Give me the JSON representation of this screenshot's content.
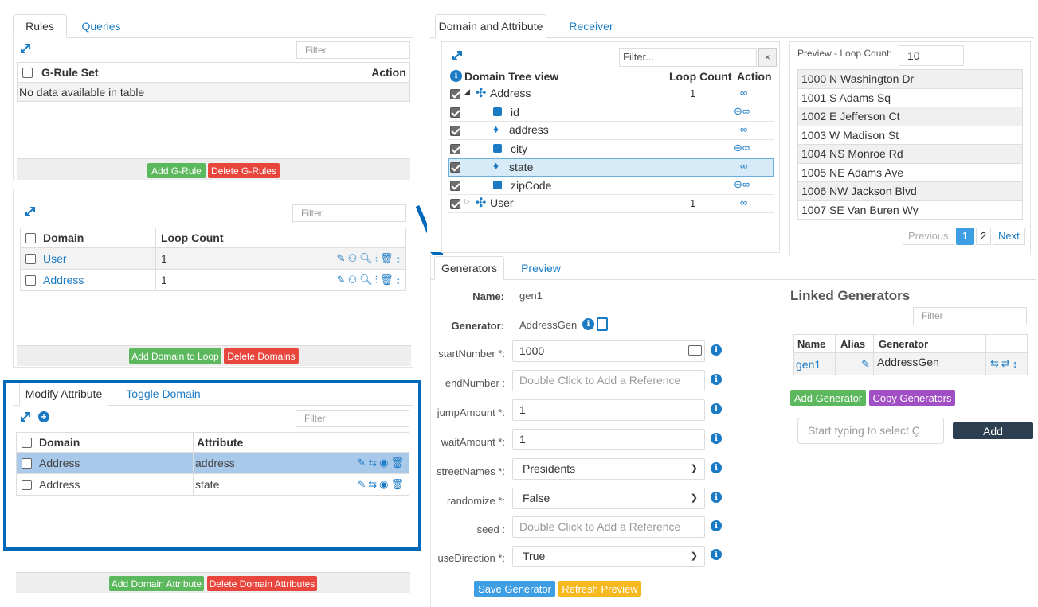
{
  "left_top": {
    "tabs": [
      "Rules",
      "Queries"
    ],
    "filter_placeholder": "Filter",
    "columns": [
      "G-Rule Set",
      "Action"
    ],
    "empty_text": "No data available in table",
    "buttons": {
      "add": "Add G-Rule",
      "delete": "Delete G-Rules"
    }
  },
  "left_mid": {
    "filter_placeholder": "Filter",
    "columns": [
      "Domain",
      "Loop Count"
    ],
    "rows": [
      {
        "domain": "User",
        "loop_count": "1"
      },
      {
        "domain": "Address",
        "loop_count": "1"
      }
    ],
    "buttons": {
      "add": "Add Domain to Loop",
      "delete": "Delete Domains"
    }
  },
  "left_bottom": {
    "tabs": [
      "Modify Attribute",
      "Toggle Domain"
    ],
    "filter_placeholder": "Filter",
    "columns": [
      "Domain",
      "Attribute"
    ],
    "rows": [
      {
        "domain": "Address",
        "attribute": "address"
      },
      {
        "domain": "Address",
        "attribute": "state"
      }
    ],
    "buttons": {
      "add": "Add Domain Attribute",
      "delete": "Delete Domain Attributes"
    }
  },
  "domain_panel": {
    "tabs": [
      "Domain and Attribute",
      "Receiver"
    ],
    "filter_placeholder": "Filter...",
    "clear_label": "×",
    "columns": {
      "tree": "Domain Tree view",
      "loop": "Loop Count",
      "action": "Action"
    },
    "tree": [
      {
        "label": "Address",
        "loop": "1"
      },
      {
        "label": "id",
        "loop": ""
      },
      {
        "label": "address",
        "loop": ""
      },
      {
        "label": "city",
        "loop": ""
      },
      {
        "label": "state",
        "loop": ""
      },
      {
        "label": "zipCode",
        "loop": ""
      },
      {
        "label": "User",
        "loop": "1"
      }
    ]
  },
  "preview": {
    "label": "Preview - Loop Count:",
    "loop_count": "10",
    "items": [
      "1000 N Washington Dr",
      "1001 S Adams Sq",
      "1002 E Jefferson Ct",
      "1003 W Madison St",
      "1004 NS Monroe Rd",
      "1005 NE Adams Ave",
      "1006 NW Jackson Blvd",
      "1007 SE Van Buren Wy"
    ],
    "pagination": {
      "previous": "Previous",
      "page1": "1",
      "page2": "2",
      "next": "Next"
    }
  },
  "generators": {
    "tabs": [
      "Generators",
      "Preview"
    ],
    "name_label": "Name:",
    "name_value": "gen1",
    "generator_label": "Generator:",
    "generator_value": "AddressGen",
    "fields": [
      {
        "label": "startNumber *:",
        "value": "1000",
        "placeholder": ""
      },
      {
        "label": "endNumber :",
        "value": "",
        "placeholder": "Double Click to Add a Reference"
      },
      {
        "label": "jumpAmount *:",
        "value": "1",
        "placeholder": ""
      },
      {
        "label": "waitAmount *:",
        "value": "1",
        "placeholder": ""
      },
      {
        "label": "streetNames *:",
        "value": "Presidents",
        "placeholder": ""
      },
      {
        "label": "randomize *:",
        "value": "False",
        "placeholder": ""
      },
      {
        "label": "seed :",
        "value": "",
        "placeholder": "Double Click to Add a Reference"
      },
      {
        "label": "useDirection *:",
        "value": "True",
        "placeholder": ""
      }
    ],
    "buttons": {
      "save": "Save Generator",
      "refresh": "Refresh Preview"
    }
  },
  "linked": {
    "title": "Linked Generators",
    "filter_placeholder": "Filter",
    "columns": [
      "Name",
      "Alias",
      "Generator"
    ],
    "rows": [
      {
        "name": "gen1",
        "alias": "",
        "generator": "AddressGen"
      }
    ],
    "buttons": {
      "add": "Add Generator",
      "copy": "Copy Generators",
      "add_small": "Add"
    },
    "select_placeholder": "Start typing to select Ç"
  },
  "colors": {
    "accent": "#1a7bc4",
    "highlight": "#0068b8",
    "selected_row": "#a9c9ea"
  }
}
